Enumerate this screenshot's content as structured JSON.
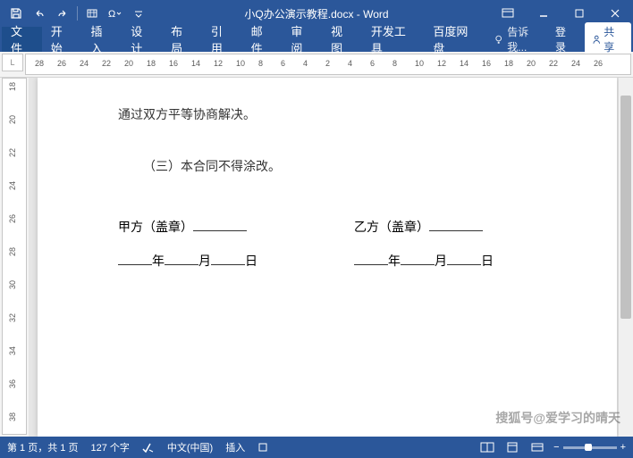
{
  "title": "小Q办公演示教程.docx - Word",
  "ribbon": {
    "file": "文件",
    "tabs": [
      "开始",
      "插入",
      "设计",
      "布局",
      "引用",
      "邮件",
      "审阅",
      "视图",
      "开发工具",
      "百度网盘"
    ],
    "tellme": "告诉我...",
    "signin": "登录",
    "share": "共享"
  },
  "ruler": {
    "corner": "L",
    "h": [
      "28",
      "26",
      "24",
      "22",
      "20",
      "18",
      "16",
      "14",
      "12",
      "10",
      "8",
      "6",
      "4",
      "2",
      "4",
      "6",
      "8",
      "10",
      "12",
      "14",
      "16",
      "18",
      "20",
      "22",
      "24",
      "26"
    ],
    "v": [
      "18",
      "20",
      "22",
      "24",
      "26",
      "28",
      "30",
      "32",
      "34",
      "36",
      "38"
    ]
  },
  "doc": {
    "line1": "通过双方平等协商解决。",
    "line2": "（三）本合同不得涂改。",
    "partyA": "甲方（盖章）",
    "partyB": "乙方（盖章）",
    "year": "年",
    "month": "月",
    "day": "日"
  },
  "status": {
    "page": "第 1 页，共 1 页",
    "words": "127 个字",
    "lang": "中文(中国)",
    "mode": "插入"
  },
  "watermark": "搜狐号@爱学习的晴天"
}
